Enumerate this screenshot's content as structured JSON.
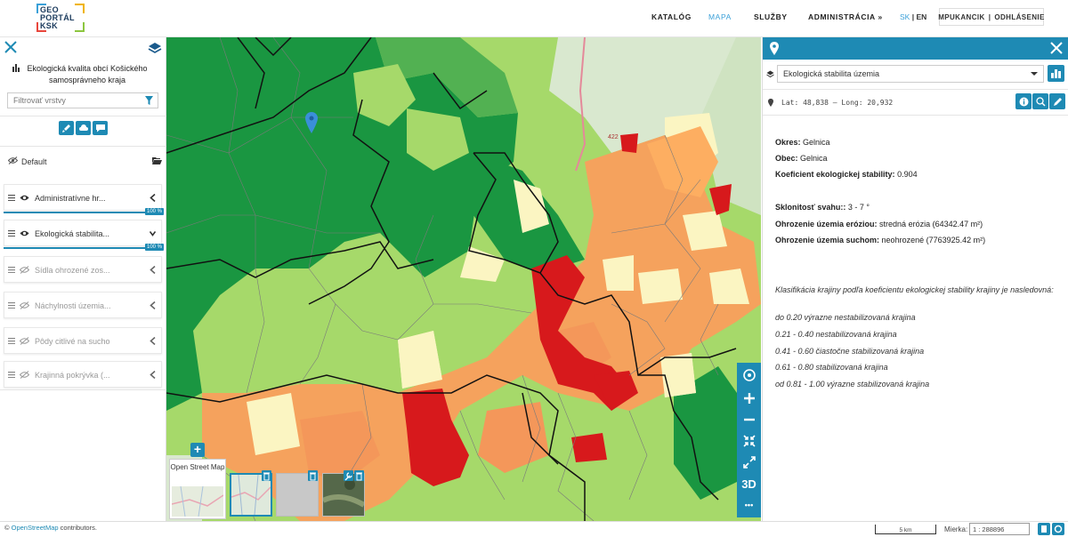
{
  "header": {
    "logo_line1": "GEO",
    "logo_line2": "PORTÁL",
    "logo_line3": "KSK",
    "nav": [
      "KATALÓG",
      "MAPA",
      "SLUŽBY",
      "ADMINISTRÁCIA »"
    ],
    "active_nav": "MAPA",
    "lang_sk": "SK",
    "lang_sep": "|",
    "lang_en": "EN",
    "user": "MPUKANCIK",
    "user_sep": "|",
    "logout": "ODHLÁSENIE"
  },
  "sidebar": {
    "title": "Ekologická kvalita obcí Košického samosprávneho kraja",
    "filter_placeholder": "Filtrovať vrstvy",
    "group": "Default",
    "layers": [
      {
        "label": "Administratívne hr...",
        "visible": true,
        "opacity": "100 %"
      },
      {
        "label": "Ekologická stabilita...",
        "visible": true,
        "opacity": "100 %"
      },
      {
        "label": "Sídla ohrozené zos...",
        "visible": false
      },
      {
        "label": "Náchylnosti územia...",
        "visible": false
      },
      {
        "label": "Pôdy citlivé na sucho",
        "visible": false
      },
      {
        "label": "Krajinná pokrývka (...",
        "visible": false
      }
    ]
  },
  "map": {
    "basemap_label": "Open Street Map",
    "ctrl_3d": "3D",
    "ctrl_more": "•••",
    "road_label": "422"
  },
  "info_panel": {
    "layer_select": "Ekologická stabilita územia",
    "coords": "Lat: 48,838 – Long: 20,932",
    "fields": [
      {
        "label": "Okres:",
        "value": "Gelnica"
      },
      {
        "label": "Obec:",
        "value": "Gelnica"
      },
      {
        "label": "Koeficient ekologickej stability:",
        "value": "0.904"
      },
      {
        "label": "Sklonitosť svahu::",
        "value": "3 - 7 °"
      },
      {
        "label": "Ohrozenie územia eróziou:",
        "value": "stredná erózia (64342.47 m²)"
      },
      {
        "label": "Ohrozenie územia suchom:",
        "value": "neohrozené (7763925.42 m²)"
      }
    ],
    "classification_intro": "Klasifikácia krajiny podľa koeficientu ekologickej stability krajiny je nasledovná:",
    "classes": [
      "do 0.20 výrazne nestabilizovaná krajina",
      "0.21 - 0.40 nestabilizovaná krajina",
      "0.41 - 0.60 čiastočne stabilizovaná krajina",
      "0.61 - 0.80 stabilizovaná krajina",
      "od 0.81 - 1.00 výrazne stabilizovaná krajina"
    ]
  },
  "footer": {
    "attribution_prefix": "© ",
    "attribution_link": "OpenStreetMap",
    "attribution_suffix": " contributors.",
    "scale": "5 km",
    "mierka_label": "Mierka:",
    "mierka_value": "1 : 288896"
  },
  "colors": {
    "accent": "#1e8ab4",
    "class_very_unstable": "#d7191c",
    "class_unstable": "#f5a25d",
    "class_partial": "#fbf5c2",
    "class_stable": "#a6d96a",
    "class_very_stable": "#1a9641"
  }
}
